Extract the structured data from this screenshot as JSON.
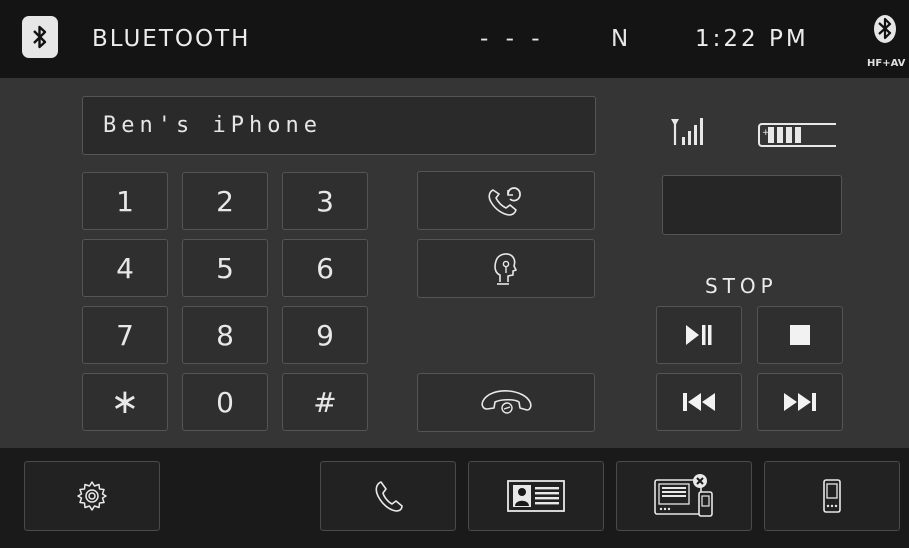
{
  "header": {
    "title": "BLUETOOTH",
    "dashes": "- - -",
    "band": "N",
    "clock": "1:22 PM",
    "mode": "HF+AV"
  },
  "device": {
    "name": "Ben's iPhone"
  },
  "keypad": {
    "keys": [
      "1",
      "2",
      "3",
      "4",
      "5",
      "6",
      "7",
      "8",
      "9",
      "∗",
      "0",
      "#"
    ]
  },
  "media": {
    "status": "STOP"
  },
  "icons": {
    "header_left": "bluetooth-icon",
    "header_right": "bluetooth-icon",
    "redial": "redial-icon",
    "voice": "voice-recognition-icon",
    "hangup": "hang-up-icon",
    "signal": "signal-strength-icon",
    "battery": "battery-icon",
    "play_pause": "play-pause-icon",
    "stop": "stop-icon",
    "previous": "previous-track-icon",
    "next": "next-track-icon",
    "settings": "gear-icon",
    "phone": "phone-icon",
    "contacts": "contacts-icon",
    "disconnect": "disconnect-device-icon",
    "device": "mobile-device-icon"
  },
  "colors": {
    "header_bg": "#141414",
    "main_bg": "#353535",
    "footer_bg": "#1a1a1a",
    "text": "#e8e8e8"
  }
}
